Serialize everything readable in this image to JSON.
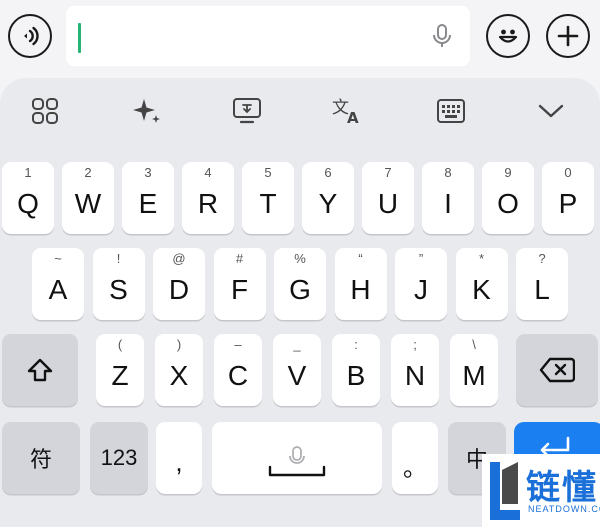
{
  "input": {
    "value": ""
  },
  "toolbar": {
    "icons": [
      "apps-grid-icon",
      "sparkle-icon",
      "screen-icon",
      "translate-icon",
      "keyboard-icon",
      "chevron-down-icon"
    ]
  },
  "rows": {
    "row1": [
      {
        "main": "Q",
        "sub": "1"
      },
      {
        "main": "W",
        "sub": "2"
      },
      {
        "main": "E",
        "sub": "3"
      },
      {
        "main": "R",
        "sub": "4"
      },
      {
        "main": "T",
        "sub": "5"
      },
      {
        "main": "Y",
        "sub": "6"
      },
      {
        "main": "U",
        "sub": "7"
      },
      {
        "main": "I",
        "sub": "8"
      },
      {
        "main": "O",
        "sub": "9"
      },
      {
        "main": "P",
        "sub": "0"
      }
    ],
    "row2": [
      {
        "main": "A",
        "sub": "~"
      },
      {
        "main": "S",
        "sub": "!"
      },
      {
        "main": "D",
        "sub": "@"
      },
      {
        "main": "F",
        "sub": "#"
      },
      {
        "main": "G",
        "sub": "%"
      },
      {
        "main": "H",
        "sub": "“"
      },
      {
        "main": "J",
        "sub": "”"
      },
      {
        "main": "K",
        "sub": "*"
      },
      {
        "main": "L",
        "sub": "?"
      }
    ],
    "row3": [
      {
        "main": "Z",
        "sub": "("
      },
      {
        "main": "X",
        "sub": ")"
      },
      {
        "main": "C",
        "sub": "–"
      },
      {
        "main": "V",
        "sub": "_"
      },
      {
        "main": "B",
        "sub": ":"
      },
      {
        "main": "N",
        "sub": ";"
      },
      {
        "main": "M",
        "sub": "\\"
      }
    ]
  },
  "bottom": {
    "symbols_label": "符",
    "numbers_label": "123",
    "comma_label": ",",
    "period_label": "。",
    "lang_label": "中"
  },
  "watermark": {
    "text": "链懂",
    "sub": "NEATDOWN.COM"
  },
  "colors": {
    "enter": "#1a7ff0",
    "caret": "#22b573",
    "watermark": "#1a6fd8"
  }
}
